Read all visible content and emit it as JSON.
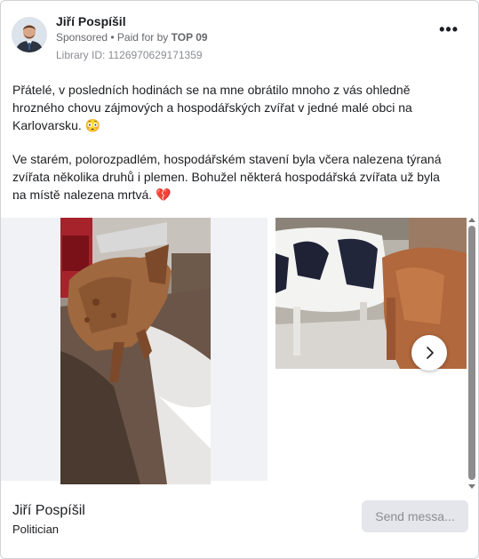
{
  "post": {
    "author_name": "Jiří Pospíšil",
    "sponsored": "Sponsored",
    "paid_prefix": " • Paid for by ",
    "paid_by": "TOP 09",
    "library_id": "Library ID: 1126970629171359",
    "paragraph1": "Přátelé, v posledních hodinách se na mne obrátilo mnoho z vás ohledně hrozného chovu zájmových a hospodářských zvířat v jedné malé obci na Karlovarsku. 😳",
    "paragraph2": "Ve starém, polorozpadlém, hospodářském stavení byla včera nalezena týraná zvířata několika druhů i plemen. Bohužel některá hospodářská zvířata už byla na místě nalezena mrtvá. 💔",
    "ellipsis": "..."
  },
  "footer": {
    "page_name": "Jiří Pospíšil",
    "category": "Politician",
    "send_button": "Send messa..."
  },
  "icons": {
    "more": "more-options-icon",
    "next": "chevron-right-icon"
  }
}
